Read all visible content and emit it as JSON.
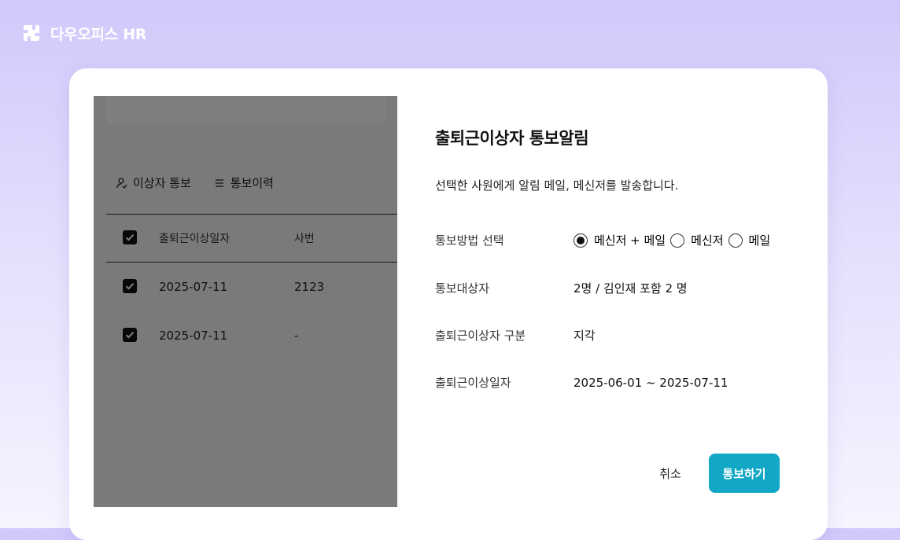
{
  "brand": {
    "name": "다우오피스 HR",
    "logo_icon": "puzzle-logo"
  },
  "background": {
    "tabs": [
      {
        "label": "이상자 통보",
        "icon": "user-check-icon"
      },
      {
        "label": "통보이력",
        "icon": "list-icon"
      }
    ],
    "table": {
      "headers": [
        "출퇴근이상일자",
        "사번"
      ],
      "rows": [
        {
          "date": "2025-07-11",
          "id": "2123",
          "checked": true
        },
        {
          "date": "2025-07-11",
          "id": "-",
          "checked": true
        }
      ]
    }
  },
  "dialog": {
    "title": "출퇴근이상자 통보알림",
    "description": "선택한 사원에게 알림 메일, 메신저를 발송합니다.",
    "method": {
      "label": "통보방법 선택",
      "options": [
        "메신저 + 메일",
        "메신저",
        "메일"
      ],
      "selected": "메신저 + 메일"
    },
    "target": {
      "label": "통보대상자",
      "value": "2명 / 김인재 포함 2 명"
    },
    "category": {
      "label": "출퇴근이상자 구분",
      "value": "지각"
    },
    "date_range": {
      "label": "출퇴근이상일자",
      "value": "2025-06-01 ~ 2025-07-11"
    },
    "buttons": {
      "cancel": "취소",
      "submit": "통보하기"
    }
  },
  "colors": {
    "accent": "#12a7c5",
    "background_top": "#d2c8fb",
    "overlay": "rgba(0,0,0,0.5)"
  }
}
